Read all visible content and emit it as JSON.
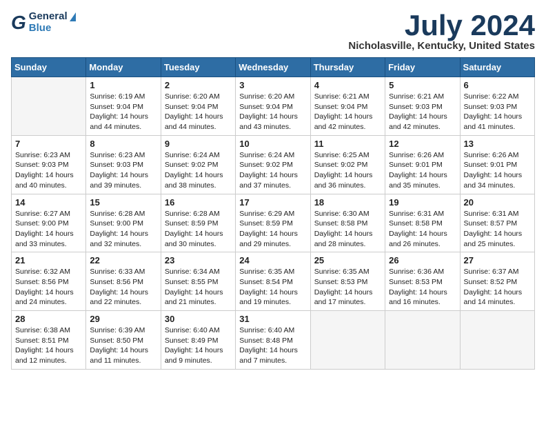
{
  "header": {
    "logo_general": "General",
    "logo_blue": "Blue",
    "title": "July 2024",
    "location": "Nicholasville, Kentucky, United States"
  },
  "days_of_week": [
    "Sunday",
    "Monday",
    "Tuesday",
    "Wednesday",
    "Thursday",
    "Friday",
    "Saturday"
  ],
  "weeks": [
    [
      {
        "num": "",
        "empty": true
      },
      {
        "num": "1",
        "sunrise": "Sunrise: 6:19 AM",
        "sunset": "Sunset: 9:04 PM",
        "daylight": "Daylight: 14 hours and 44 minutes."
      },
      {
        "num": "2",
        "sunrise": "Sunrise: 6:20 AM",
        "sunset": "Sunset: 9:04 PM",
        "daylight": "Daylight: 14 hours and 44 minutes."
      },
      {
        "num": "3",
        "sunrise": "Sunrise: 6:20 AM",
        "sunset": "Sunset: 9:04 PM",
        "daylight": "Daylight: 14 hours and 43 minutes."
      },
      {
        "num": "4",
        "sunrise": "Sunrise: 6:21 AM",
        "sunset": "Sunset: 9:04 PM",
        "daylight": "Daylight: 14 hours and 42 minutes."
      },
      {
        "num": "5",
        "sunrise": "Sunrise: 6:21 AM",
        "sunset": "Sunset: 9:03 PM",
        "daylight": "Daylight: 14 hours and 42 minutes."
      },
      {
        "num": "6",
        "sunrise": "Sunrise: 6:22 AM",
        "sunset": "Sunset: 9:03 PM",
        "daylight": "Daylight: 14 hours and 41 minutes."
      }
    ],
    [
      {
        "num": "7",
        "sunrise": "Sunrise: 6:23 AM",
        "sunset": "Sunset: 9:03 PM",
        "daylight": "Daylight: 14 hours and 40 minutes."
      },
      {
        "num": "8",
        "sunrise": "Sunrise: 6:23 AM",
        "sunset": "Sunset: 9:03 PM",
        "daylight": "Daylight: 14 hours and 39 minutes."
      },
      {
        "num": "9",
        "sunrise": "Sunrise: 6:24 AM",
        "sunset": "Sunset: 9:02 PM",
        "daylight": "Daylight: 14 hours and 38 minutes."
      },
      {
        "num": "10",
        "sunrise": "Sunrise: 6:24 AM",
        "sunset": "Sunset: 9:02 PM",
        "daylight": "Daylight: 14 hours and 37 minutes."
      },
      {
        "num": "11",
        "sunrise": "Sunrise: 6:25 AM",
        "sunset": "Sunset: 9:02 PM",
        "daylight": "Daylight: 14 hours and 36 minutes."
      },
      {
        "num": "12",
        "sunrise": "Sunrise: 6:26 AM",
        "sunset": "Sunset: 9:01 PM",
        "daylight": "Daylight: 14 hours and 35 minutes."
      },
      {
        "num": "13",
        "sunrise": "Sunrise: 6:26 AM",
        "sunset": "Sunset: 9:01 PM",
        "daylight": "Daylight: 14 hours and 34 minutes."
      }
    ],
    [
      {
        "num": "14",
        "sunrise": "Sunrise: 6:27 AM",
        "sunset": "Sunset: 9:00 PM",
        "daylight": "Daylight: 14 hours and 33 minutes."
      },
      {
        "num": "15",
        "sunrise": "Sunrise: 6:28 AM",
        "sunset": "Sunset: 9:00 PM",
        "daylight": "Daylight: 14 hours and 32 minutes."
      },
      {
        "num": "16",
        "sunrise": "Sunrise: 6:28 AM",
        "sunset": "Sunset: 8:59 PM",
        "daylight": "Daylight: 14 hours and 30 minutes."
      },
      {
        "num": "17",
        "sunrise": "Sunrise: 6:29 AM",
        "sunset": "Sunset: 8:59 PM",
        "daylight": "Daylight: 14 hours and 29 minutes."
      },
      {
        "num": "18",
        "sunrise": "Sunrise: 6:30 AM",
        "sunset": "Sunset: 8:58 PM",
        "daylight": "Daylight: 14 hours and 28 minutes."
      },
      {
        "num": "19",
        "sunrise": "Sunrise: 6:31 AM",
        "sunset": "Sunset: 8:58 PM",
        "daylight": "Daylight: 14 hours and 26 minutes."
      },
      {
        "num": "20",
        "sunrise": "Sunrise: 6:31 AM",
        "sunset": "Sunset: 8:57 PM",
        "daylight": "Daylight: 14 hours and 25 minutes."
      }
    ],
    [
      {
        "num": "21",
        "sunrise": "Sunrise: 6:32 AM",
        "sunset": "Sunset: 8:56 PM",
        "daylight": "Daylight: 14 hours and 24 minutes."
      },
      {
        "num": "22",
        "sunrise": "Sunrise: 6:33 AM",
        "sunset": "Sunset: 8:56 PM",
        "daylight": "Daylight: 14 hours and 22 minutes."
      },
      {
        "num": "23",
        "sunrise": "Sunrise: 6:34 AM",
        "sunset": "Sunset: 8:55 PM",
        "daylight": "Daylight: 14 hours and 21 minutes."
      },
      {
        "num": "24",
        "sunrise": "Sunrise: 6:35 AM",
        "sunset": "Sunset: 8:54 PM",
        "daylight": "Daylight: 14 hours and 19 minutes."
      },
      {
        "num": "25",
        "sunrise": "Sunrise: 6:35 AM",
        "sunset": "Sunset: 8:53 PM",
        "daylight": "Daylight: 14 hours and 17 minutes."
      },
      {
        "num": "26",
        "sunrise": "Sunrise: 6:36 AM",
        "sunset": "Sunset: 8:53 PM",
        "daylight": "Daylight: 14 hours and 16 minutes."
      },
      {
        "num": "27",
        "sunrise": "Sunrise: 6:37 AM",
        "sunset": "Sunset: 8:52 PM",
        "daylight": "Daylight: 14 hours and 14 minutes."
      }
    ],
    [
      {
        "num": "28",
        "sunrise": "Sunrise: 6:38 AM",
        "sunset": "Sunset: 8:51 PM",
        "daylight": "Daylight: 14 hours and 12 minutes."
      },
      {
        "num": "29",
        "sunrise": "Sunrise: 6:39 AM",
        "sunset": "Sunset: 8:50 PM",
        "daylight": "Daylight: 14 hours and 11 minutes."
      },
      {
        "num": "30",
        "sunrise": "Sunrise: 6:40 AM",
        "sunset": "Sunset: 8:49 PM",
        "daylight": "Daylight: 14 hours and 9 minutes."
      },
      {
        "num": "31",
        "sunrise": "Sunrise: 6:40 AM",
        "sunset": "Sunset: 8:48 PM",
        "daylight": "Daylight: 14 hours and 7 minutes."
      },
      {
        "num": "",
        "empty": true
      },
      {
        "num": "",
        "empty": true
      },
      {
        "num": "",
        "empty": true
      }
    ]
  ]
}
